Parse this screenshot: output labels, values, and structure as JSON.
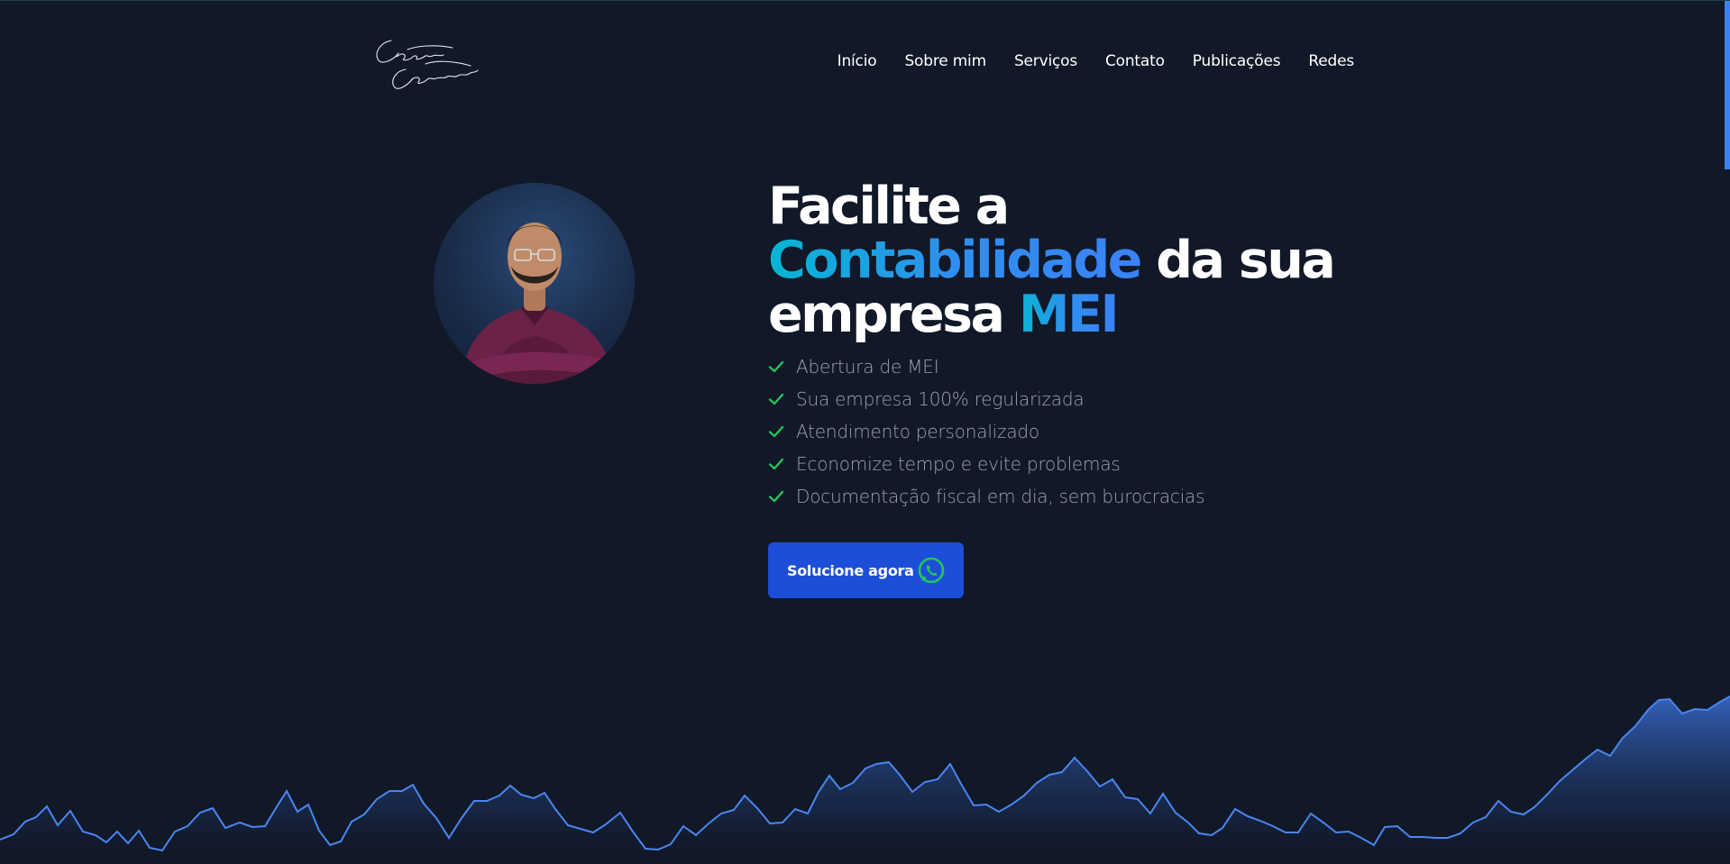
{
  "brand": {
    "logo_text": "Cezar Cardoso"
  },
  "nav": {
    "items": [
      "Início",
      "Sobre mim",
      "Serviços",
      "Contato",
      "Publicações",
      "Redes"
    ]
  },
  "hero": {
    "title_line1": "Facilite a",
    "title_highlight": "Contabilidade",
    "title_line2": " da sua",
    "title_line3": "empresa ",
    "title_highlight2": "MEI",
    "features": [
      "Abertura de MEI",
      "Sua empresa 100% regularizada",
      "Atendimento personalizado",
      "Economize tempo e evite problemas",
      "Documentação fiscal em dia, sem burocracias"
    ],
    "cta_label": "Solucione agora"
  },
  "colors": {
    "background": "#111827",
    "accent_cyan": "#06b6d4",
    "accent_blue": "#3b82f6",
    "button": "#1d4ed8",
    "check": "#22c55e",
    "whatsapp": "#22c55e"
  },
  "icons": {
    "check": "check-icon",
    "cta": "whatsapp-icon"
  }
}
